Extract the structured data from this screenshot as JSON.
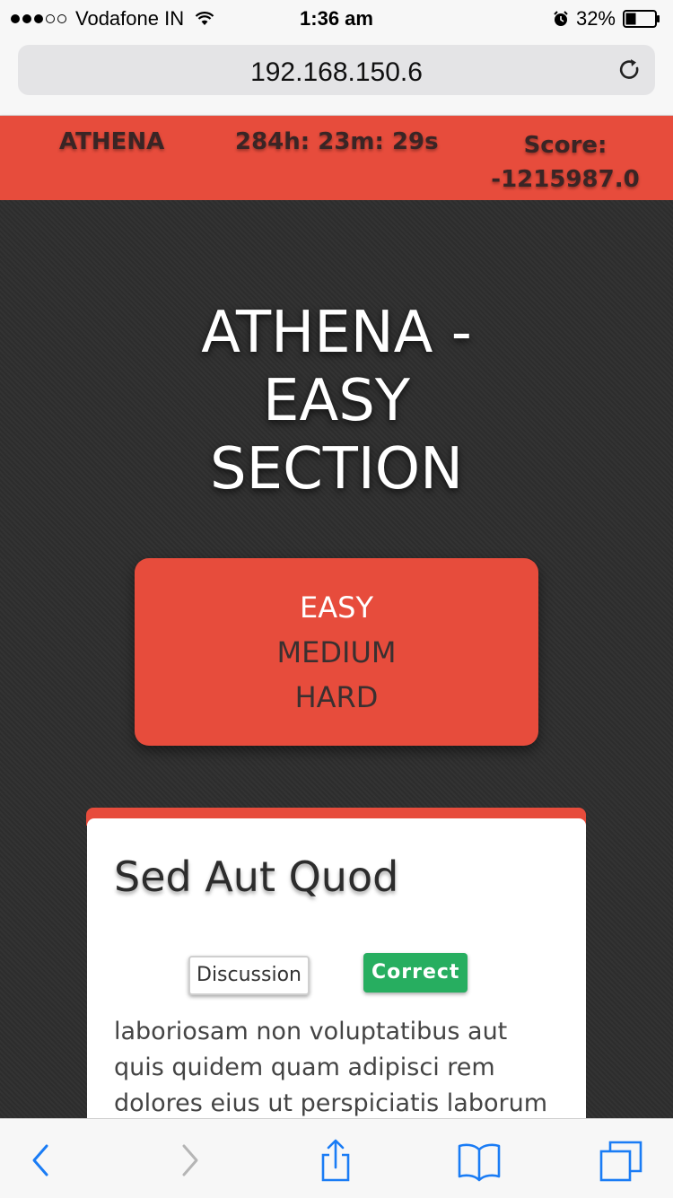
{
  "status_bar": {
    "carrier": "Vodafone IN",
    "time": "1:36 am",
    "battery": "32%",
    "signal_bars_filled": 3,
    "signal_bars_total": 5
  },
  "browser": {
    "url": "192.168.150.6"
  },
  "header": {
    "brand": "ATHENA",
    "timer": "284h: 23m: 29s",
    "score_label": "Score:",
    "score_value": "-1215987.0"
  },
  "page": {
    "title_line1": "ATHENA -",
    "title_line2": "EASY",
    "title_line3": "SECTION"
  },
  "difficulty": {
    "options": [
      "EASY",
      "MEDIUM",
      "HARD"
    ],
    "selected": "EASY"
  },
  "question_card": {
    "title": "Sed Aut Quod",
    "discussion_label": "Discussion",
    "status_label": "Correct",
    "body": "laboriosam non voluptatibus aut quis quidem quam adipisci rem dolores eius ut perspiciatis laborum"
  },
  "colors": {
    "accent": "#e74c3c",
    "success": "#27ae60",
    "background": "#2e2e2e",
    "ios_blue": "#1a7cf5"
  },
  "toolbar": {
    "icons": [
      "back-icon",
      "forward-icon",
      "share-icon",
      "bookmarks-icon",
      "tabs-icon"
    ]
  }
}
